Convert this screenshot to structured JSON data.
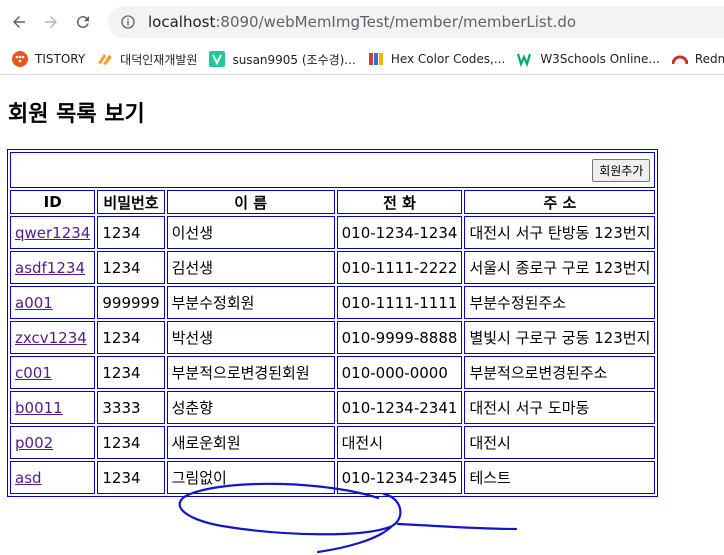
{
  "browser": {
    "url_host": "localhost",
    "url_rest": ":8090/webMemImgTest/member/memberList.do"
  },
  "bookmarks": [
    {
      "label": "TISTORY",
      "icon": "tistory-icon",
      "color": "#eb531f"
    },
    {
      "label": "대덕인재개발원",
      "icon": "daedeok-icon",
      "color": "#f39c2c"
    },
    {
      "label": "susan9905 (조수경)...",
      "icon": "velog-icon",
      "color": "#20c997"
    },
    {
      "label": "Hex Color Codes,...",
      "icon": "book-icon",
      "color": "#2e6fd8"
    },
    {
      "label": "W3Schools Online...",
      "icon": "w3schools-icon",
      "color": "#04aa6d"
    },
    {
      "label": "Redm",
      "icon": "redmine-icon",
      "color": "#c9302c"
    }
  ],
  "page": {
    "title": "회원 목록 보기",
    "add_button": "회원추가"
  },
  "table": {
    "headers": [
      "ID",
      "비밀번호",
      "이 름",
      "전 화",
      "주 소"
    ],
    "rows": [
      {
        "id": "qwer1234",
        "pw": "1234",
        "name": "이선생",
        "phone": "010-1234-1234",
        "addr": "대전시 서구 탄방동 123번지"
      },
      {
        "id": "asdf1234",
        "pw": "1234",
        "name": "김선생",
        "phone": "010-1111-2222",
        "addr": "서울시 종로구 구로 123번지"
      },
      {
        "id": "a001",
        "pw": "999999",
        "name": "부분수정회원",
        "phone": "010-1111-1111",
        "addr": "부분수정된주소"
      },
      {
        "id": "zxcv1234",
        "pw": "1234",
        "name": "박선생",
        "phone": "010-9999-8888",
        "addr": "별빛시 구로구 궁동 123번지"
      },
      {
        "id": "c001",
        "pw": "1234",
        "name": "부분적으로변경된회원",
        "phone": "010-000-0000",
        "addr": "부분적으로변경된주소"
      },
      {
        "id": "b0011",
        "pw": "3333",
        "name": "성춘향",
        "phone": "010-1234-2341",
        "addr": "대전시 서구 도마동"
      },
      {
        "id": "p002",
        "pw": "1234",
        "name": "새로운회원",
        "phone": "대전시",
        "addr": "대전시"
      },
      {
        "id": "asd",
        "pw": "1234",
        "name": "그림없이",
        "phone": "010-1234-2345",
        "addr": "테스트"
      }
    ]
  },
  "annotation": {
    "color": "#1414c8"
  }
}
